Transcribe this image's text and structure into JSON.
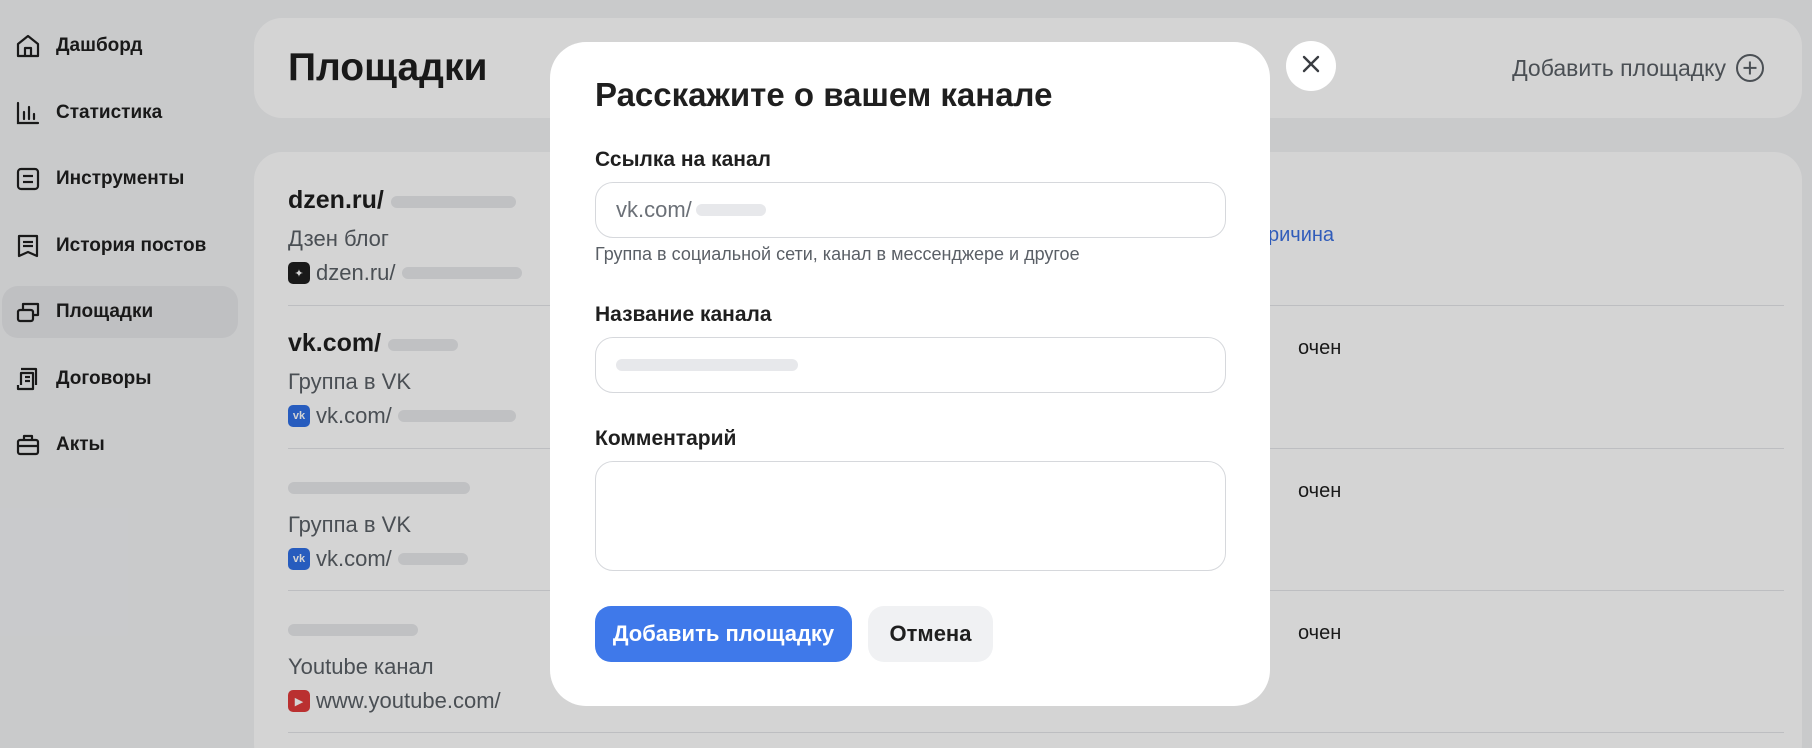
{
  "sidebar": {
    "items": [
      {
        "label": "Дашборд",
        "icon": "home-icon"
      },
      {
        "label": "Статистика",
        "icon": "bar-chart-icon"
      },
      {
        "label": "Инструменты",
        "icon": "tools-icon"
      },
      {
        "label": "История постов",
        "icon": "history-icon"
      },
      {
        "label": "Площадки",
        "icon": "platforms-icon",
        "active": true
      },
      {
        "label": "Договоры",
        "icon": "contract-icon"
      },
      {
        "label": "Акты",
        "icon": "briefcase-icon"
      }
    ]
  },
  "header": {
    "title": "Площадки",
    "add_label": "Добавить площадку"
  },
  "platforms": [
    {
      "title": "dzen.ru/",
      "subtitle": "Дзен блог",
      "link": "dzen.ru/",
      "icon": "dzen-icon",
      "status": "ричина"
    },
    {
      "title": "vk.com/",
      "subtitle": "Группа в VK",
      "link": "vk.com/",
      "icon": "vk-icon",
      "status": "очен"
    },
    {
      "title": "",
      "subtitle": "Группа в VK",
      "link": "vk.com/",
      "icon": "vk-icon",
      "status": "очен"
    },
    {
      "title": "",
      "subtitle": "Youtube канал",
      "link": "www.youtube.com/",
      "icon": "youtube-icon",
      "status": "очен"
    }
  ],
  "modal": {
    "title": "Расскажите о вашем канале",
    "link_field": {
      "label": "Ссылка на канал",
      "value": "vk.com/",
      "hint": "Группа в социальной сети, канал в мессенджере и другое"
    },
    "name_field": {
      "label": "Название канала",
      "value": ""
    },
    "comment_field": {
      "label": "Комментарий",
      "value": ""
    },
    "submit_label": "Добавить площадку",
    "cancel_label": "Отмена"
  },
  "colors": {
    "accent": "#3f79ea",
    "link": "#3a6fe0",
    "background": "#f2f3f5"
  }
}
